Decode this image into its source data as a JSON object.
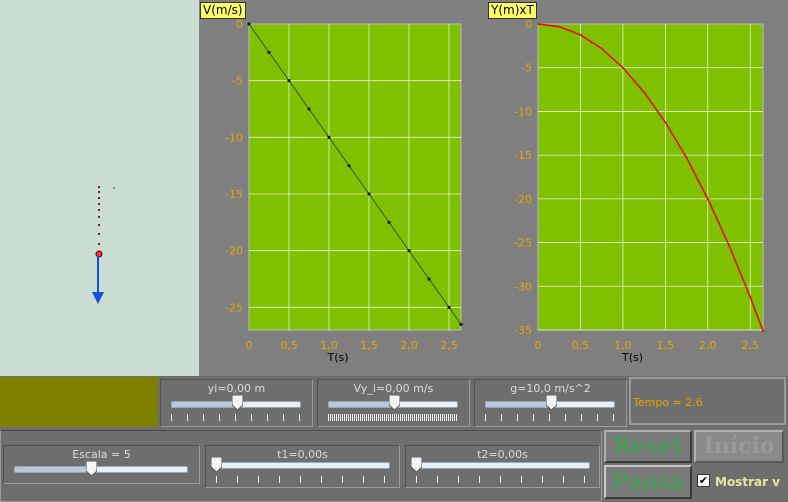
{
  "velocity_plot": {
    "title": "V(m/s)",
    "xlabel": "T(s)",
    "x_ticks": [
      "0",
      "0,5",
      "1,0",
      "1,5",
      "2,0",
      "2,5"
    ],
    "y_ticks": [
      "0",
      "-5",
      "-10",
      "-15",
      "-20",
      "-25"
    ]
  },
  "position_plot": {
    "title": "Y(m)xT",
    "xlabel": "T(s)",
    "x_ticks": [
      "0",
      "0,5",
      "1,0",
      "1,5",
      "2,0",
      "2,5"
    ],
    "y_ticks": [
      "0",
      "-5",
      "-10",
      "-15",
      "-20",
      "-25",
      "-30",
      "-35"
    ]
  },
  "chart_data": [
    {
      "type": "scatter",
      "title": "V(m/s)",
      "xlabel": "T(s)",
      "ylabel": "V(m/s)",
      "xlim": [
        0,
        2.65
      ],
      "ylim": [
        -27,
        0
      ],
      "x": [
        0,
        0.25,
        0.5,
        0.75,
        1.0,
        1.25,
        1.5,
        1.75,
        2.0,
        2.25,
        2.5,
        2.65
      ],
      "y": [
        0,
        -2.5,
        -5,
        -7.5,
        -10,
        -12.5,
        -15,
        -17.5,
        -20,
        -22.5,
        -25,
        -26.5
      ],
      "grid": true
    },
    {
      "type": "line",
      "title": "Y(m)xT",
      "xlabel": "T(s)",
      "ylabel": "Y(m)",
      "xlim": [
        0,
        2.65
      ],
      "ylim": [
        -35,
        0
      ],
      "x": [
        0,
        0.25,
        0.5,
        0.75,
        1.0,
        1.25,
        1.5,
        1.75,
        2.0,
        2.25,
        2.5,
        2.65
      ],
      "y": [
        0,
        -0.31,
        -1.25,
        -2.81,
        -5.0,
        -7.81,
        -11.25,
        -15.31,
        -20.0,
        -25.31,
        -31.25,
        -35.11
      ],
      "grid": true
    }
  ],
  "controls": {
    "yi_label": "yi=0,00 m",
    "yi_value": 0.5,
    "vyi_label": "Vy_i=0,00 m/s",
    "vyi_value": 0.5,
    "g_label": "g=10,0 m/s^2",
    "g_value": 0.5,
    "tempo_label": "Tempo = 2.6",
    "escala_label": "Escala = 5",
    "escala_value": 0.45,
    "t1_label": "t1=0,00s",
    "t1_value": 0.0,
    "t2_label": "t2=0,00s",
    "t2_value": 0.0,
    "reset_label": "Reset",
    "inicio_label": "Início",
    "pausa_label": "Pausa",
    "mostrar_label": "Mostrar v",
    "mostrar_checked": true
  },
  "colors": {
    "plot_bg": "#7fc000",
    "grid": "#e8f0d0",
    "axis_text": "#e6a800",
    "tempo_text": "#f0a000"
  }
}
